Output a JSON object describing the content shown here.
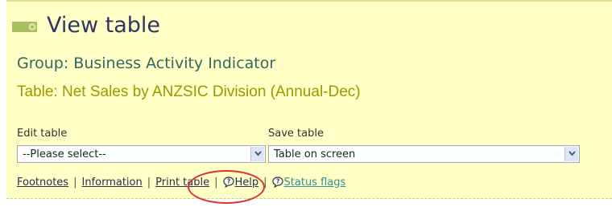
{
  "header": {
    "title": "View table"
  },
  "group_line": "Group: Business Activity Indicator",
  "table_line": "Table: Net Sales by ANZSIC Division (Annual-Dec)",
  "edit_table": {
    "label": "Edit table",
    "value": "--Please select--"
  },
  "save_table": {
    "label": "Save table",
    "value": "Table on screen"
  },
  "links": {
    "footnotes": "Footnotes",
    "information": "Information",
    "print_table": "Print table",
    "help": "Help",
    "status_flags": "Status flags",
    "separator": "|"
  },
  "colors": {
    "panel": "#ffffc6",
    "highlight_circle": "#e03030",
    "title": "#333366",
    "table_line": "#999900"
  }
}
